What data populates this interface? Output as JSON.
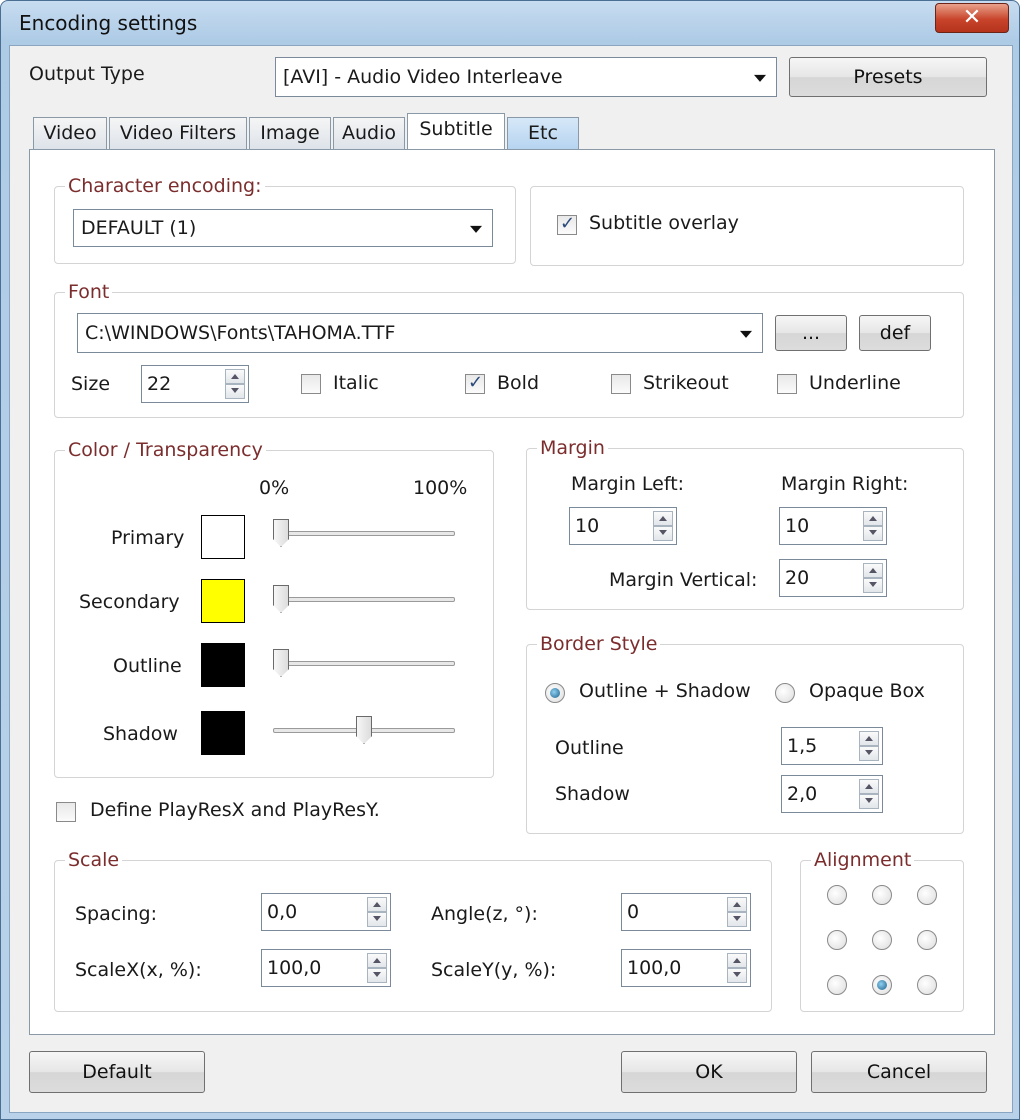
{
  "window": {
    "title": "Encoding settings",
    "close_glyph": "✕"
  },
  "output_type": {
    "label": "Output Type",
    "value": "[AVI] - Audio Video Interleave",
    "presets_label": "Presets"
  },
  "tabs": [
    {
      "label": "Video"
    },
    {
      "label": "Video Filters"
    },
    {
      "label": "Image"
    },
    {
      "label": "Audio"
    },
    {
      "label": "Subtitle",
      "active": true
    },
    {
      "label": "Etc"
    }
  ],
  "char_encoding": {
    "legend": "Character encoding:",
    "value": "DEFAULT (1)"
  },
  "overlay": {
    "label": "Subtitle overlay",
    "checked": true
  },
  "font": {
    "legend": "Font",
    "path": "C:\\WINDOWS\\Fonts\\TAHOMA.TTF",
    "browse_label": "...",
    "def_label": "def",
    "size_label": "Size",
    "size_value": "22",
    "italic": "Italic",
    "bold": "Bold",
    "strikeout": "Strikeout",
    "underline": "Underline"
  },
  "color": {
    "legend": "Color / Transparency",
    "pct_min": "0%",
    "pct_max": "100%",
    "rows": [
      {
        "label": "Primary",
        "color": "#ffffff",
        "transparency": 0.05
      },
      {
        "label": "Secondary",
        "color": "#ffff00",
        "transparency": 0.05
      },
      {
        "label": "Outline",
        "color": "#000000",
        "transparency": 0.05
      },
      {
        "label": "Shadow",
        "color": "#000000",
        "transparency": 0.5
      }
    ]
  },
  "playres": {
    "label": "Define PlayResX and PlayResY."
  },
  "margin": {
    "legend": "Margin",
    "left_label": "Margin Left:",
    "left_value": "10",
    "right_label": "Margin Right:",
    "right_value": "10",
    "vertical_label": "Margin Vertical:",
    "vertical_value": "20"
  },
  "border": {
    "legend": "Border Style",
    "opt1": "Outline + Shadow",
    "opt2": "Opaque Box",
    "outline_label": "Outline",
    "outline_value": "1,5",
    "shadow_label": "Shadow",
    "shadow_value": "2,0"
  },
  "scale": {
    "legend": "Scale",
    "spacing_label": "Spacing:",
    "spacing_value": "0,0",
    "angle_label": "Angle(z, °):",
    "angle_value": "0",
    "scalex_label": "ScaleX(x, %):",
    "scalex_value": "100,0",
    "scaley_label": "ScaleY(y, %):",
    "scaley_value": "100,0"
  },
  "alignment": {
    "legend": "Alignment",
    "selected": 8
  },
  "buttons": {
    "default": "Default",
    "ok": "OK",
    "cancel": "Cancel"
  }
}
